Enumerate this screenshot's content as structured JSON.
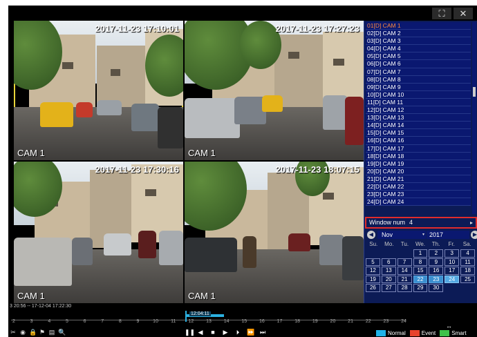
{
  "window_controls": {
    "fullscreen_icon": "fullscreen-icon",
    "close_icon": "close-icon",
    "fullscreen_glyph": "⛶",
    "close_glyph": "✕"
  },
  "tiles": [
    {
      "timestamp": "2017-11-23 17:10:01",
      "camera": "CAM 1",
      "selected": true
    },
    {
      "timestamp": "2017-11-23 17:27:23",
      "camera": "CAM 1",
      "selected": false
    },
    {
      "timestamp": "2017-11-23 17:30:16",
      "camera": "CAM 1",
      "selected": false
    },
    {
      "timestamp": "2017-11-23 18:07:15",
      "camera": "CAM 1",
      "selected": false
    }
  ],
  "cameras": [
    "01[D] CAM 1",
    "02[D] CAM 2",
    "03[D] CAM 3",
    "04[D] CAM 4",
    "05[D] CAM 5",
    "06[D] CAM 6",
    "07[D] CAM 7",
    "08[D] CAM 8",
    "09[D] CAM 9",
    "10[D] CAM 10",
    "11[D] CAM 11",
    "12[D] CAM 12",
    "13[D] CAM 13",
    "14[D] CAM 14",
    "15[D] CAM 15",
    "16[D] CAM 16",
    "17[D] CAM 17",
    "18[D] CAM 18",
    "19[D] CAM 19",
    "20[D] CAM 20",
    "21[D] CAM 21",
    "22[D] CAM 22",
    "23[D] CAM 23",
    "24[D] CAM 24"
  ],
  "active_camera_index": 0,
  "window_num": {
    "label": "Window num",
    "value": "4",
    "arrow": "▸"
  },
  "calendar": {
    "month": "Nov",
    "year": "2017",
    "prev_glyph": "◀",
    "next_glyph": "▶",
    "dropdown_glyph": "▾",
    "weekdays": [
      "Su.",
      "Mo.",
      "Tu.",
      "We.",
      "Th.",
      "Fr.",
      "Sa."
    ],
    "days": [
      "",
      "",
      "",
      "1",
      "2",
      "3",
      "4",
      "5",
      "6",
      "7",
      "8",
      "9",
      "10",
      "11",
      "12",
      "13",
      "14",
      "15",
      "16",
      "17",
      "18",
      "19",
      "20",
      "21",
      "22",
      "23",
      "24",
      "25",
      "26",
      "27",
      "28",
      "29",
      "30",
      "",
      ""
    ],
    "recorded_days": [
      "22",
      "23"
    ],
    "today": "24"
  },
  "timeline": {
    "range_label": "3 20:56 -- 17-12-04 17:22:30",
    "current_time": "12:04:11",
    "hours": [
      "2",
      "3",
      "4",
      "5",
      "6",
      "7",
      "8",
      "9",
      "10",
      "11",
      "12",
      "13",
      "14",
      "15",
      "16",
      "17",
      "18",
      "19",
      "20",
      "21",
      "22",
      "23",
      "24"
    ],
    "zoom_glyph": "↔"
  },
  "toolbar_left": [
    {
      "name": "cut-icon",
      "glyph": "✂"
    },
    {
      "name": "camera-icon",
      "glyph": "◉"
    },
    {
      "name": "lock-icon",
      "glyph": "🔒"
    },
    {
      "name": "flag-icon",
      "glyph": "⚑"
    },
    {
      "name": "folder-icon",
      "glyph": "▤"
    },
    {
      "name": "zoom-icon",
      "glyph": "🔍"
    }
  ],
  "playback": [
    {
      "name": "pause-button",
      "glyph": "❚❚"
    },
    {
      "name": "reverse-play-button",
      "glyph": "◀"
    },
    {
      "name": "stop-button",
      "glyph": "■"
    },
    {
      "name": "play-button",
      "glyph": "▶"
    },
    {
      "name": "slow-button",
      "glyph": "⏵"
    },
    {
      "name": "fast-forward-button",
      "glyph": "⏩"
    },
    {
      "name": "step-button",
      "glyph": "⏭"
    }
  ],
  "legend": [
    {
      "label": "Normal",
      "color": "#1fb2e8"
    },
    {
      "label": "Event",
      "color": "#e8432c"
    },
    {
      "label": "Smart",
      "color": "#3fc24a"
    }
  ],
  "colors": {
    "panel_bg": "#0c1b56",
    "selected_tile": "#e8d53a",
    "active_camera": "#ff8a3d",
    "window_num_border": "#e12c2c",
    "timeline_blue": "#2bb0e0"
  }
}
